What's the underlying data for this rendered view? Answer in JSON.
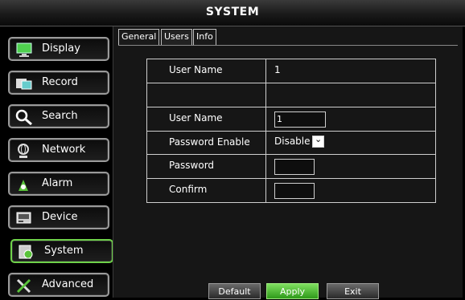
{
  "window": {
    "title": "SYSTEM"
  },
  "sidebar": {
    "items": [
      {
        "label": "Display",
        "icon": "monitor-icon"
      },
      {
        "label": "Record",
        "icon": "record-icon"
      },
      {
        "label": "Search",
        "icon": "search-icon"
      },
      {
        "label": "Network",
        "icon": "network-icon"
      },
      {
        "label": "Alarm",
        "icon": "alarm-icon"
      },
      {
        "label": "Device",
        "icon": "device-icon"
      },
      {
        "label": "System",
        "icon": "system-icon",
        "active": true
      },
      {
        "label": "Advanced",
        "icon": "tools-icon"
      }
    ]
  },
  "tabs": [
    {
      "label": "General"
    },
    {
      "label": "Users",
      "active": true
    },
    {
      "label": "Info"
    }
  ],
  "users_form": {
    "rows": [
      {
        "label": "User Name",
        "value": "1"
      },
      {
        "label": "",
        "value": ""
      },
      {
        "label": "User Name",
        "value": "1"
      },
      {
        "label": "Password Enable",
        "value": "Disable"
      },
      {
        "label": "Password",
        "value": ""
      },
      {
        "label": "Confirm",
        "value": ""
      }
    ]
  },
  "buttons": {
    "default": "Default",
    "apply": "Apply",
    "exit": "Exit"
  },
  "colors": {
    "accent": "#6fd24a",
    "background": "#161616"
  }
}
